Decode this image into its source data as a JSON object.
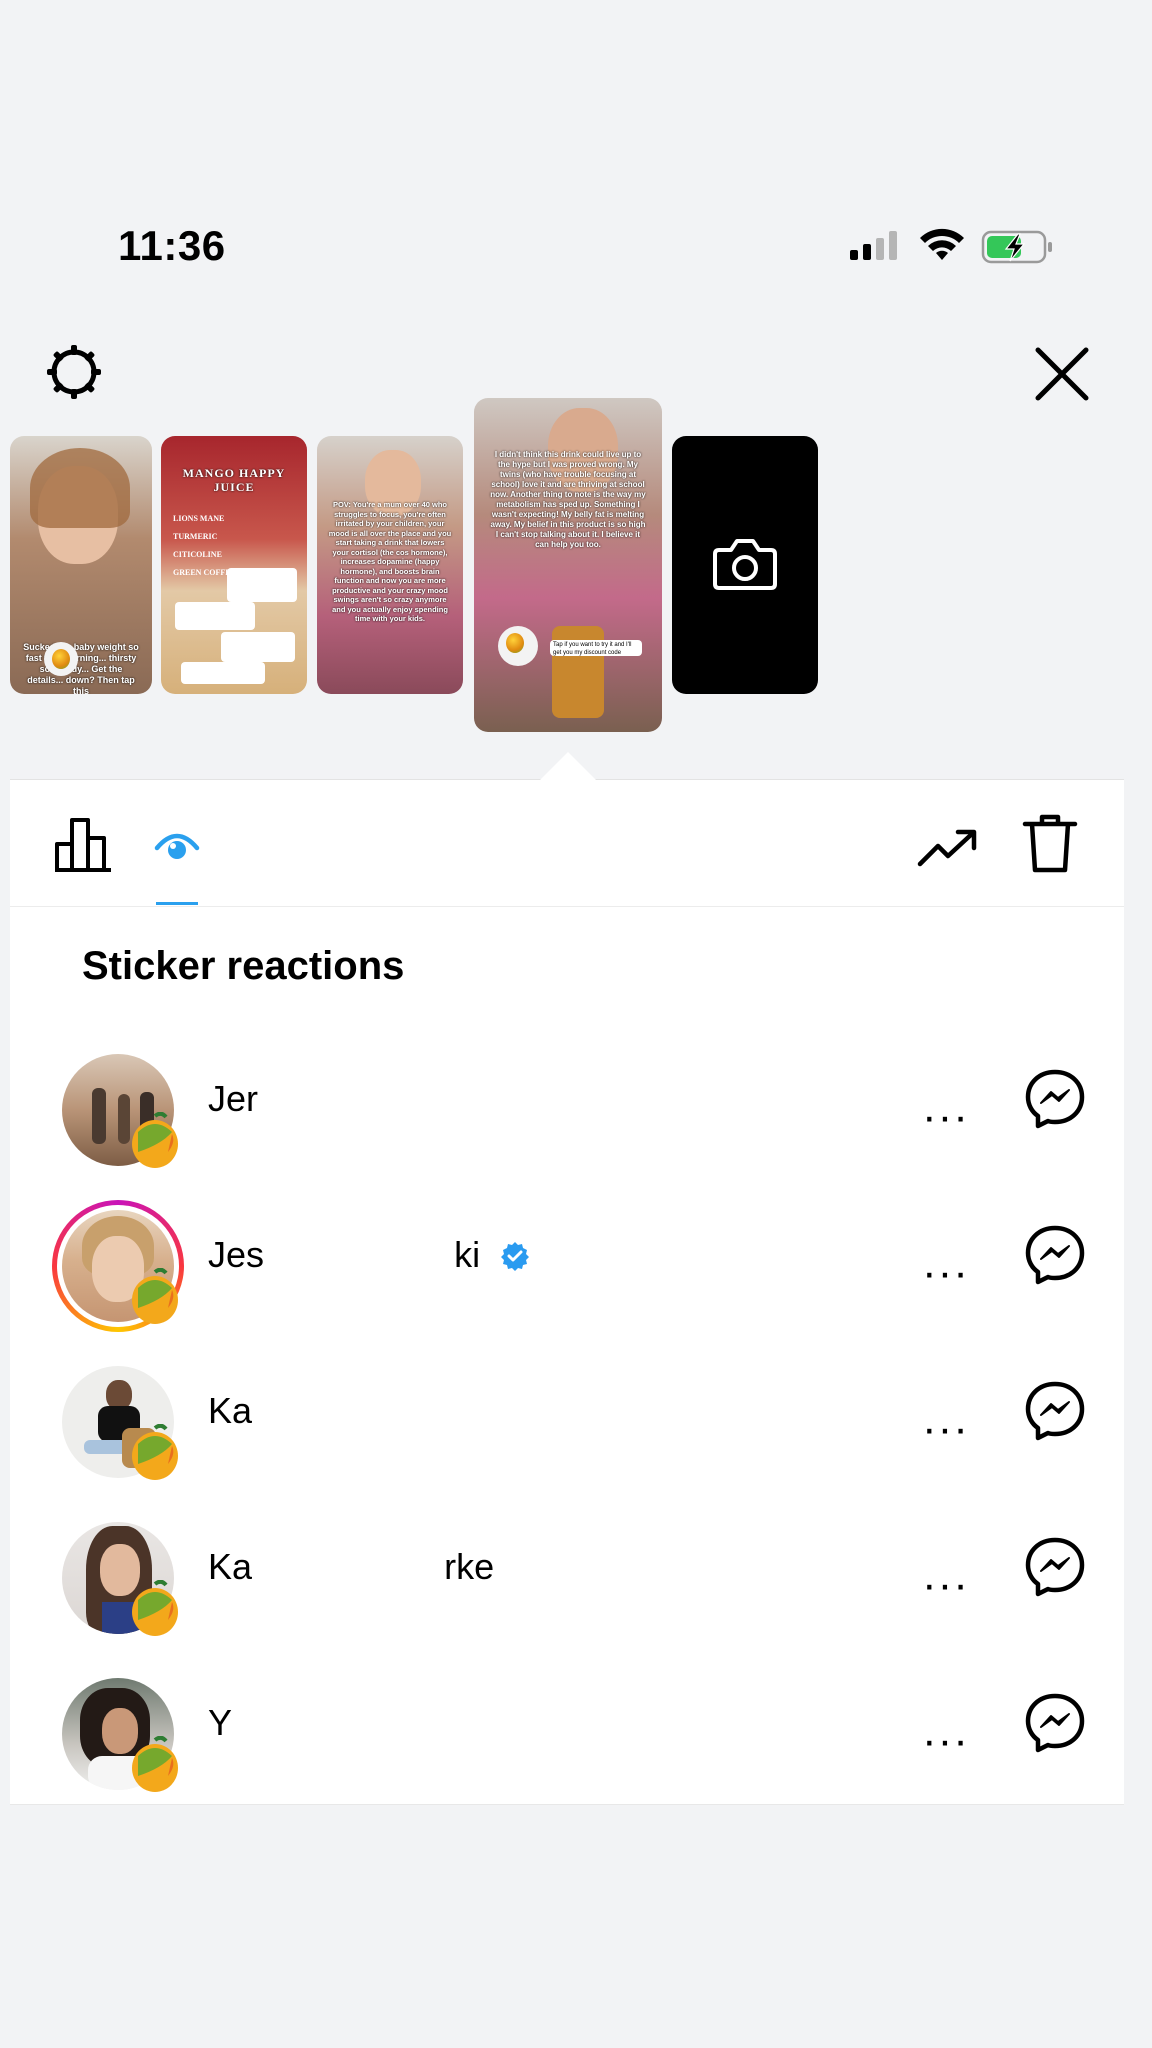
{
  "status": {
    "time": "11:36"
  },
  "header": {
    "settings_icon": "gear-icon",
    "close_icon": "close-icon"
  },
  "thumbnails": [
    {
      "caption": "Sucked the baby weight so fast this morning... thirsty so bloody... Get the details... down? Then tap this"
    },
    {
      "caption": "MANGO HAPPY JUICE",
      "list": [
        "LIONS MANE",
        "TURMERIC",
        "CITICOLINE",
        "GREEN COFFEE BEAN"
      ]
    },
    {
      "caption": "POV: You're a mum over 40 who struggles to focus, you're often irritated by your children, your mood is all over the place and you start taking a drink that lowers your cortisol (the cos hormone), increases dopamine (happy hormone), and boosts brain function and now you are more productive and your crazy mood swings aren't so crazy anymore and you actually enjoy spending time with your kids."
    },
    {
      "caption": "I didn't think this drink could live up to the hype but I was proved wrong. My twins (who have trouble focusing at school) love it and are thriving at school now. Another thing to note is the way my metabolism has sped up. Something I wasn't expecting! My belly fat is melting away. My belief in this product is so high I can't stop talking about it. I believe it can help you too.",
      "button": "Tap if you want to try it and I'll get you my discount code"
    },
    {
      "icon": "camera-icon"
    }
  ],
  "tabs": {
    "insights_icon": "bar-chart-icon",
    "viewers_icon": "eye-icon",
    "boost_icon": "trending-up-icon",
    "delete_icon": "trash-icon"
  },
  "section": {
    "title": "Sticker reactions"
  },
  "reactions": [
    {
      "name_start": "Jer",
      "name_end": "",
      "verified": false,
      "story_ring": false
    },
    {
      "name_start": "Jes",
      "name_end": "ki",
      "verified": true,
      "story_ring": true
    },
    {
      "name_start": "Ka",
      "name_end": "",
      "verified": false,
      "story_ring": false
    },
    {
      "name_start": "Ka",
      "name_end": "rke",
      "verified": false,
      "story_ring": false
    },
    {
      "name_start": "Y",
      "name_end": "",
      "verified": false,
      "story_ring": false
    }
  ],
  "row_actions": {
    "more_label": "···",
    "message_icon": "messenger-icon",
    "reaction_icon": "mango-icon"
  },
  "colors": {
    "accent": "#2aa0ee",
    "background": "#f2f3f5",
    "panel": "#ffffff"
  }
}
